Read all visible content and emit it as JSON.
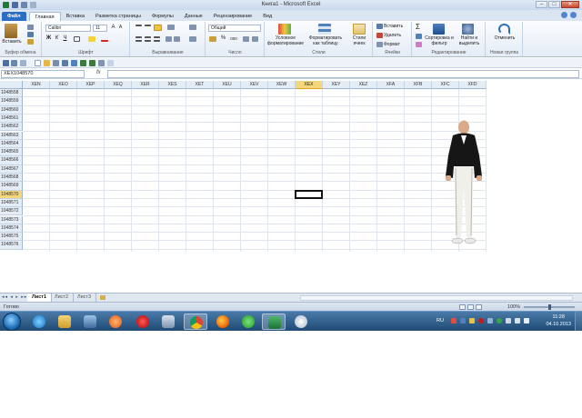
{
  "window": {
    "title": "Книга1 - Microsoft Excel",
    "minimize": "–",
    "maximize": "□",
    "close": "✕"
  },
  "ribbon_tabs": [
    "Файл",
    "Главная",
    "Вставка",
    "Разметка страницы",
    "Формулы",
    "Данные",
    "Рецензирование",
    "Вид"
  ],
  "ribbon": {
    "clipboard": {
      "paste": "Вставить",
      "label": "Буфер обмена"
    },
    "font": {
      "name": "Calibri",
      "size": "11",
      "bold": "Ж",
      "italic": "К",
      "underline": "Ч",
      "grow": "A",
      "shrink": "A",
      "label": "Шрифт"
    },
    "alignment": {
      "label": "Выравнивание"
    },
    "number": {
      "format": "Общий",
      "percent": "%",
      "thousands": "000",
      "label": "Число"
    },
    "styles": {
      "conditional": "Условное форматирование",
      "as_table": "Форматировать как таблицу",
      "cell_styles": "Стили ячеек",
      "label": "Стили"
    },
    "cells": {
      "insert": "Вставить",
      "delete": "Удалить",
      "format": "Формат",
      "label": "Ячейки"
    },
    "editing": {
      "sum": "Σ",
      "sort": "Сортировка и фильтр",
      "find": "Найти и выделить",
      "label": "Редактирование"
    },
    "new_group": {
      "undo": "Отменить",
      "label": "Новая группа"
    }
  },
  "formula_bar": {
    "name_box": "XEX1048570",
    "fx": "fx",
    "content": ""
  },
  "grid": {
    "columns": [
      "XEN",
      "XEO",
      "XEP",
      "XEQ",
      "XER",
      "XES",
      "XET",
      "XEU",
      "XEV",
      "XEW",
      "XEX",
      "XEY",
      "XEZ",
      "XFA",
      "XFB",
      "XFC",
      "XFD"
    ],
    "selected_column": "XEX",
    "rows": [
      "1048558",
      "1048559",
      "1048560",
      "1048561",
      "1048562",
      "1048563",
      "1048564",
      "1048565",
      "1048566",
      "1048567",
      "1048568",
      "1048569",
      "1048570",
      "1048571",
      "1048572",
      "1048573",
      "1048574",
      "1048575",
      "1048576"
    ],
    "selected_row": "1048570"
  },
  "sheets": {
    "nav": "◂◂ ◂ ▸ ▸▸",
    "tabs": [
      "Лист1",
      "Лист2",
      "Лист3"
    ],
    "active": "Лист1"
  },
  "status": {
    "ready": "Готово",
    "zoom": "100%"
  },
  "taskbar": {
    "lang": "RU",
    "time": "11:28",
    "date": "04.10.2013",
    "apps": [
      "ie-icon",
      "explorer-icon",
      "media-player-icon",
      "opera-icon",
      "settings-icon",
      "chrome-icon",
      "firefox-icon",
      "mail-icon",
      "excel-icon",
      "disk-icon"
    ]
  },
  "colors": {
    "accent": "#2b6cc4",
    "selection_header": "#f5d67a",
    "taskbar": "#1f4b75"
  }
}
